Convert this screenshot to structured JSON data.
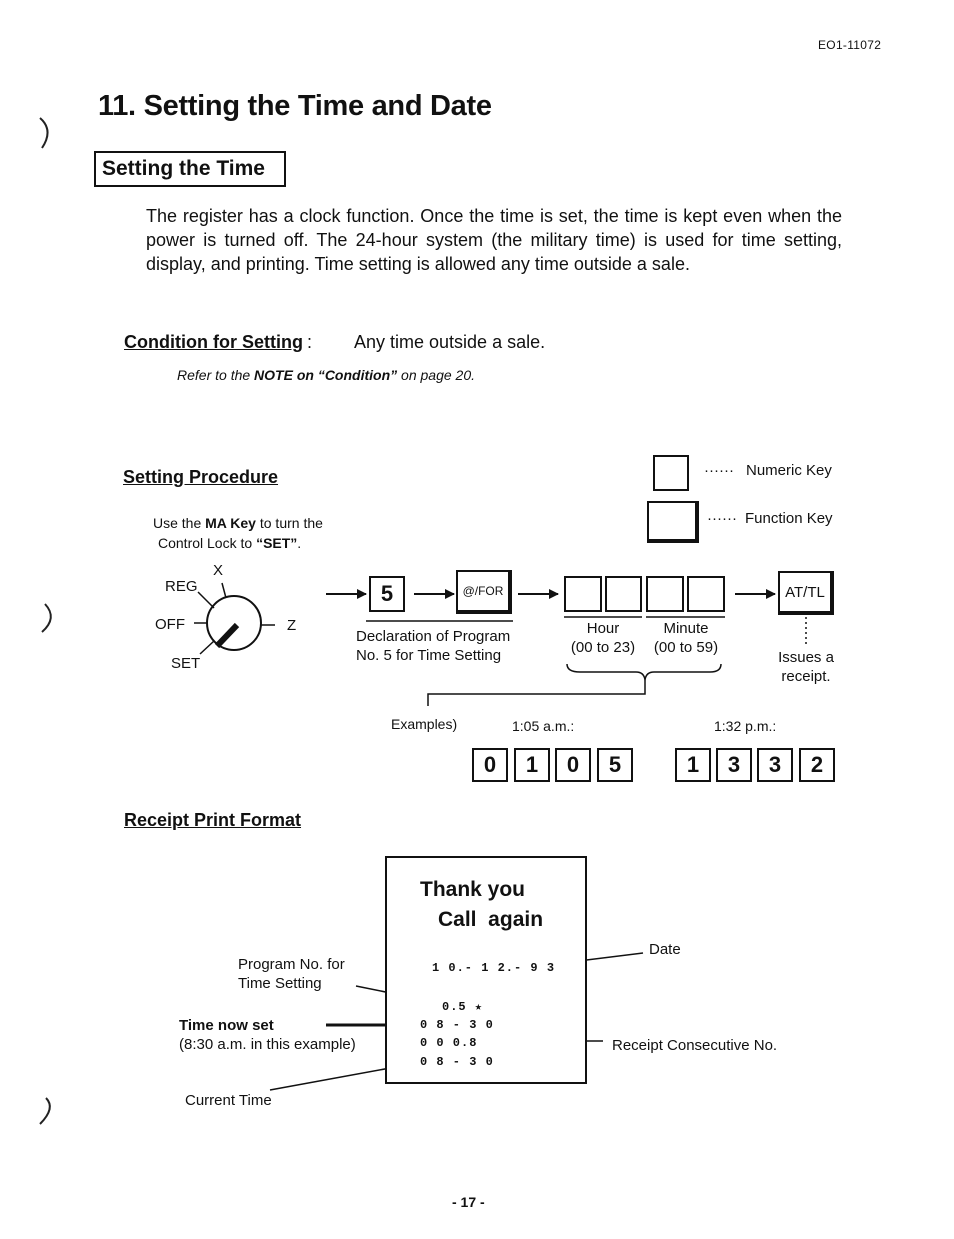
{
  "header": {
    "doc_id": "EO1-11072"
  },
  "page_title": "11. Setting the Time and Date",
  "section_title": "Setting the Time",
  "intro_paragraph": "The register has a clock function.  Once the time is set, the time is kept even when the power is turned off.  The 24-hour system (the military time) is used for time setting, display, and printing.  Time setting is allowed any time outside a sale.",
  "condition": {
    "label": "Condition for Setting",
    "colon": ":",
    "value": "Any time outside a sale.",
    "note_prefix": "Refer to the ",
    "note_bold": "NOTE on “Condition”",
    "note_suffix": " on page 20."
  },
  "procedure": {
    "heading": "Setting Procedure",
    "legend": {
      "numeric_key_dots": "······",
      "numeric_key_label": "Numeric Key",
      "function_key_dots": "······",
      "function_key_label": "Function Key"
    },
    "instruction_part1": "Use the ",
    "instruction_bold1": "MA Key",
    "instruction_part2": " to turn the",
    "instruction_line2_prefix": "Control Lock to ",
    "instruction_bold2": "“SET”",
    "instruction_line2_suffix": ".",
    "control_lock": {
      "positions": {
        "x": "X",
        "reg": "REG",
        "off": "OFF",
        "z": "Z",
        "set": "SET"
      },
      "selected": "SET"
    },
    "keys": {
      "program_no": "5",
      "function_key": "@/FOR",
      "final_key": "AT/TL"
    },
    "declaration_line1": "Declaration of Program",
    "declaration_line2": "No. 5 for Time Setting",
    "hour_label": "Hour",
    "hour_range": "(00 to 23)",
    "minute_label": "Minute",
    "minute_range": "(00 to 59)",
    "issues_line1": "Issues a",
    "issues_line2": "receipt.",
    "examples_label": "Examples)",
    "examples": [
      {
        "label": "1:05 a.m.:",
        "digits": [
          "0",
          "1",
          "0",
          "5"
        ]
      },
      {
        "label": "1:32 p.m.:",
        "digits": [
          "1",
          "3",
          "3",
          "2"
        ]
      }
    ]
  },
  "receipt_format": {
    "heading": "Receipt Print Format",
    "receipt": {
      "line1": "Thank you",
      "line2": "Call  again",
      "date": "1 0.- 1 2.- 9 3",
      "program_no": "0.5 ★",
      "time_set": "0 8 - 3 0",
      "consecutive_no": "0 0 0.8",
      "current_time": "0 8 - 3 0"
    },
    "callouts": {
      "program_no_line1": "Program No. for",
      "program_no_line2": "Time Setting",
      "time_now_set": "Time now set",
      "time_now_set_note": "(8:30 a.m. in this example)",
      "current_time": "Current Time",
      "date": "Date",
      "consecutive_no": "Receipt Consecutive No."
    }
  },
  "footer": {
    "page_number": "- 17 -"
  }
}
